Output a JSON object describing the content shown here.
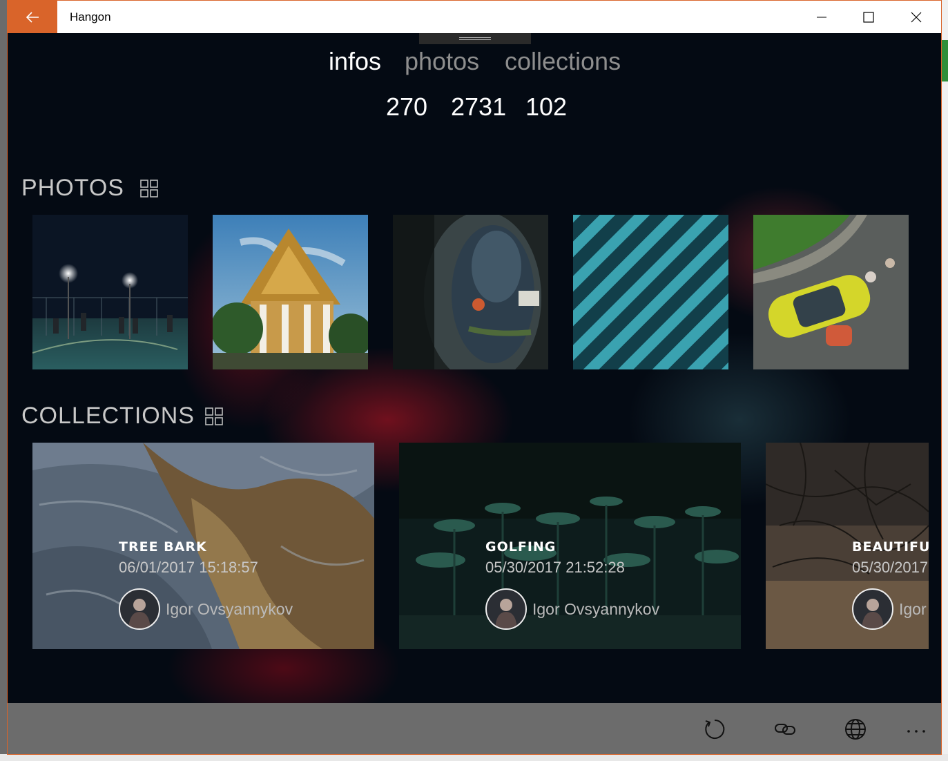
{
  "window": {
    "title": "Hangon"
  },
  "stats": {
    "tabs": [
      "infos",
      "photos",
      "collections"
    ],
    "values": [
      "270",
      "2731",
      "102"
    ]
  },
  "photos": {
    "title": "PHOTOS"
  },
  "collections": {
    "title": "COLLECTIONS",
    "items": [
      {
        "name": "TREE BARK",
        "date": "06/01/2017 15:18:57",
        "author": "Igor Ovsyannykov"
      },
      {
        "name": "GOLFING",
        "date": "05/30/2017 21:52:28",
        "author": "Igor Ovsyannykov"
      },
      {
        "name": "BEAUTIFU",
        "date": "05/30/2017",
        "author": "Igor"
      }
    ]
  },
  "toolbar": [
    "refresh-icon",
    "link-icon",
    "globe-icon",
    "more-icon"
  ],
  "colors": {
    "accent": "#d9642a",
    "background": "#040a13",
    "bottom_bar": "#6c6c6c"
  }
}
